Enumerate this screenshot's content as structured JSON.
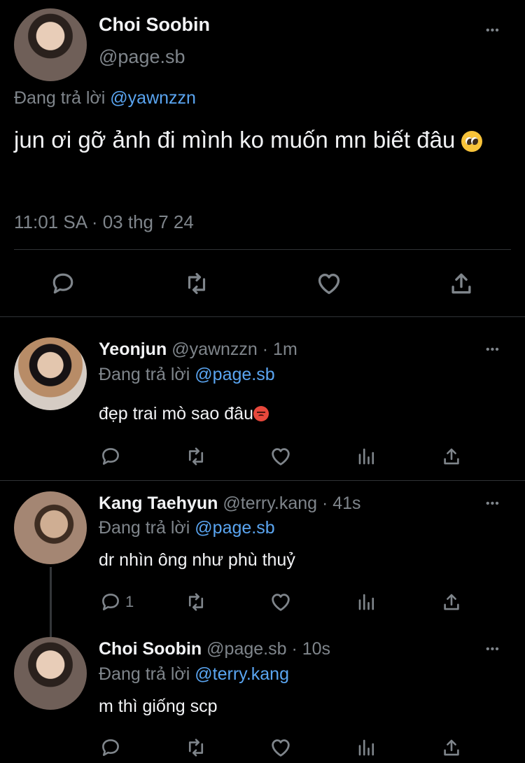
{
  "main_tweet": {
    "author_name": "Choi Soobin",
    "author_handle": "@page.sb",
    "reply_prefix": "Đang trả lời",
    "reply_to": "@yawnzzn",
    "text": "jun ơi gỡ ảnh đi mình ko muốn mn biết đâu",
    "emoji": "pleading-face",
    "timestamp": "11:01 SA · 03 thg 7 24",
    "more": "•••"
  },
  "replies": [
    {
      "author_name": "Yeonjun",
      "handle_time": "@yawnzzn · 1m",
      "reply_prefix": "Đang trả lời",
      "reply_to": "@page.sb",
      "text": "đẹp trai mò sao đâu",
      "emoji": "angry-face",
      "reply_count": "",
      "more": "•••"
    },
    {
      "author_name": "Kang Taehyun",
      "handle_time": "@terry.kang · 41s",
      "reply_prefix": "Đang trả lời",
      "reply_to": "@page.sb",
      "text": "dr nhìn ông như phù thuỷ",
      "reply_count": "1",
      "more": "•••"
    },
    {
      "author_name": "Choi Soobin",
      "handle_time": "@page.sb · 10s",
      "reply_prefix": "Đang trả lời",
      "reply_to": "@terry.kang",
      "text": "m thì giống scp",
      "reply_count": "",
      "more": "•••"
    }
  ],
  "colors": {
    "background": "#000000",
    "text": "#e7e9ea",
    "muted": "#7f858b",
    "link": "#5aa5f1",
    "separator": "#2f3336"
  }
}
